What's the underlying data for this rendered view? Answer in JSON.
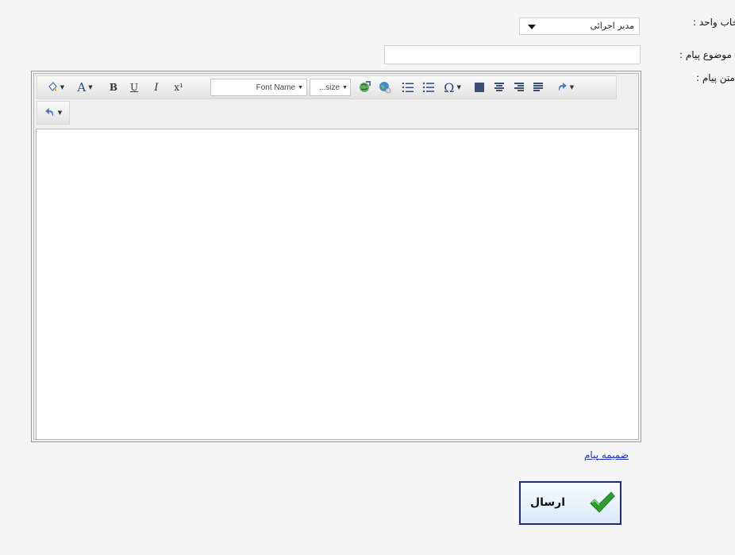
{
  "form": {
    "unit_label": "انتخاب واحد :",
    "unit_selected": "مدیر اجرائی",
    "subject_label": "موضوع پیام :",
    "subject_value": "",
    "body_label": "متن پیام :"
  },
  "editor": {
    "toolbar": {
      "font_name": "Font Name",
      "font_size": "...size",
      "bold": "B",
      "underline": "U",
      "italic": "I",
      "superscript": "x¹",
      "font_color": "A",
      "omega": "Ω"
    }
  },
  "attachment_link": "ضمیمه پیام",
  "send_button": {
    "label": "ارسال",
    "accent": "#2e9d2e"
  }
}
